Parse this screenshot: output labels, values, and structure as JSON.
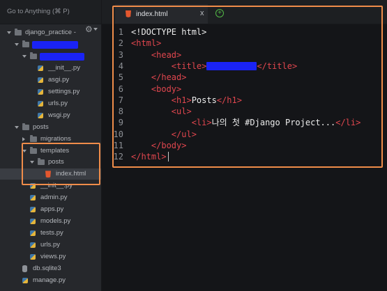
{
  "goto": {
    "label": "Go to Anything (⌘ P)"
  },
  "tab": {
    "filename": "index.html",
    "close": "x",
    "new": "+"
  },
  "tree": [
    {
      "label": "django_practice -",
      "depth": 0,
      "kind": "folder",
      "open": true
    },
    {
      "label": "",
      "depth": 1,
      "kind": "folder",
      "open": true,
      "redacted": 1
    },
    {
      "label": "",
      "depth": 2,
      "kind": "folder",
      "open": true,
      "redacted": 2
    },
    {
      "label": "__init__.py",
      "depth": 3,
      "kind": "py"
    },
    {
      "label": "asgi.py",
      "depth": 3,
      "kind": "py"
    },
    {
      "label": "settings.py",
      "depth": 3,
      "kind": "py"
    },
    {
      "label": "urls.py",
      "depth": 3,
      "kind": "py"
    },
    {
      "label": "wsgi.py",
      "depth": 3,
      "kind": "py"
    },
    {
      "label": "posts",
      "depth": 1,
      "kind": "folder",
      "open": true
    },
    {
      "label": "migrations",
      "depth": 2,
      "kind": "folder",
      "open": false
    },
    {
      "label": "templates",
      "depth": 2,
      "kind": "folder",
      "open": true
    },
    {
      "label": "posts",
      "depth": 3,
      "kind": "folder",
      "open": true
    },
    {
      "label": "index.html",
      "depth": 4,
      "kind": "html",
      "selected": true
    },
    {
      "label": "__init__.py",
      "depth": 2,
      "kind": "py"
    },
    {
      "label": "admin.py",
      "depth": 2,
      "kind": "py"
    },
    {
      "label": "apps.py",
      "depth": 2,
      "kind": "py"
    },
    {
      "label": "models.py",
      "depth": 2,
      "kind": "py"
    },
    {
      "label": "tests.py",
      "depth": 2,
      "kind": "py"
    },
    {
      "label": "urls.py",
      "depth": 2,
      "kind": "py"
    },
    {
      "label": "views.py",
      "depth": 2,
      "kind": "py"
    },
    {
      "label": "db.sqlite3",
      "depth": 1,
      "kind": "db"
    },
    {
      "label": "manage.py",
      "depth": 1,
      "kind": "py"
    }
  ],
  "code": {
    "line_numbers": [
      "1",
      "2",
      "3",
      "4",
      "5",
      "6",
      "7",
      "8",
      "9",
      "10",
      "11",
      "12"
    ],
    "l1": "<!DOCTYPE html>",
    "l2": "<html>",
    "l3": "<head>",
    "l4_open": "<title>",
    "l4_close": "</title>",
    "l5": "</head>",
    "l6": "<body>",
    "l7_open": "<h1>",
    "l7_text": "Posts",
    "l7_close": "</h1>",
    "l8": "<ul>",
    "l9_open": "<li>",
    "l9_text": "나의 첫 #Django Project...",
    "l9_close": "</li>",
    "l10": "</ul>",
    "l11": "</body>",
    "l12": "</html>"
  },
  "colors": {
    "tag": "#e0464e",
    "highlight": "#f08d4a",
    "redaction": "#1a23f5"
  }
}
